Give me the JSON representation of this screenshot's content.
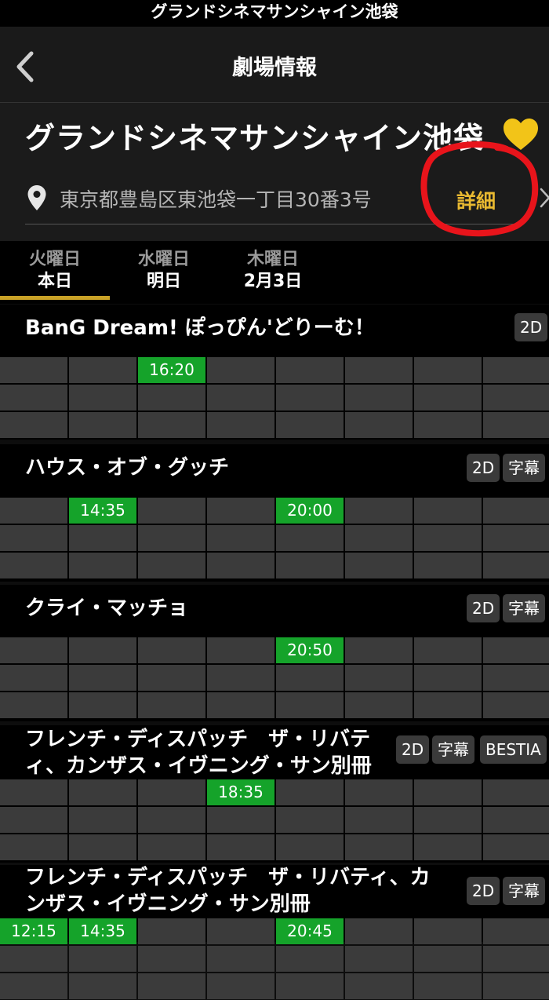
{
  "status_bar": {
    "title": "グランドシネマサンシャイン池袋"
  },
  "nav": {
    "title": "劇場情報"
  },
  "theater": {
    "name": "グランドシネマサンシャイン池袋",
    "address": "東京都豊島区東池袋一丁目30番3号",
    "detail_label": "詳細"
  },
  "tabs": [
    {
      "dow": "火曜日",
      "date": "本日",
      "selected": true
    },
    {
      "dow": "水曜日",
      "date": "明日",
      "selected": false
    },
    {
      "dow": "木曜日",
      "date": "2月3日",
      "selected": false
    }
  ],
  "movies": [
    {
      "title": "BanG Dream! ぽっぴん'どりーむ！",
      "badges": [
        "2D"
      ],
      "showtimes": [
        {
          "col": 2,
          "row": 0,
          "time": "16:20"
        }
      ]
    },
    {
      "title": "ハウス・オブ・グッチ",
      "badges": [
        "2D",
        "字幕"
      ],
      "showtimes": [
        {
          "col": 1,
          "row": 0,
          "time": "14:35"
        },
        {
          "col": 4,
          "row": 0,
          "time": "20:00"
        }
      ]
    },
    {
      "title": "クライ・マッチョ",
      "badges": [
        "2D",
        "字幕"
      ],
      "showtimes": [
        {
          "col": 4,
          "row": 0,
          "time": "20:50"
        }
      ]
    },
    {
      "title_lines": [
        "フレンチ・ディスパッチ　ザ・リバテ",
        "ィ、カンザス・イヴニング・サン別冊"
      ],
      "badges": [
        "2D",
        "字幕",
        "BESTIA"
      ],
      "showtimes": [
        {
          "col": 3,
          "row": 0,
          "time": "18:35"
        }
      ]
    },
    {
      "title_lines": [
        "フレンチ・ディスパッチ　ザ・リバティ、カ",
        "ンザス・イヴニング・サン別冊"
      ],
      "badges": [
        "2D",
        "字幕"
      ],
      "showtimes": [
        {
          "col": 0,
          "row": 0,
          "time": "12:15"
        },
        {
          "col": 1,
          "row": 0,
          "time": "14:35"
        },
        {
          "col": 4,
          "row": 0,
          "time": "20:45"
        }
      ]
    }
  ],
  "colors": {
    "accent": "#c9a227",
    "detail": "#e8b931",
    "showtime_active": "#15a32a",
    "annotation": "#e8141b"
  }
}
